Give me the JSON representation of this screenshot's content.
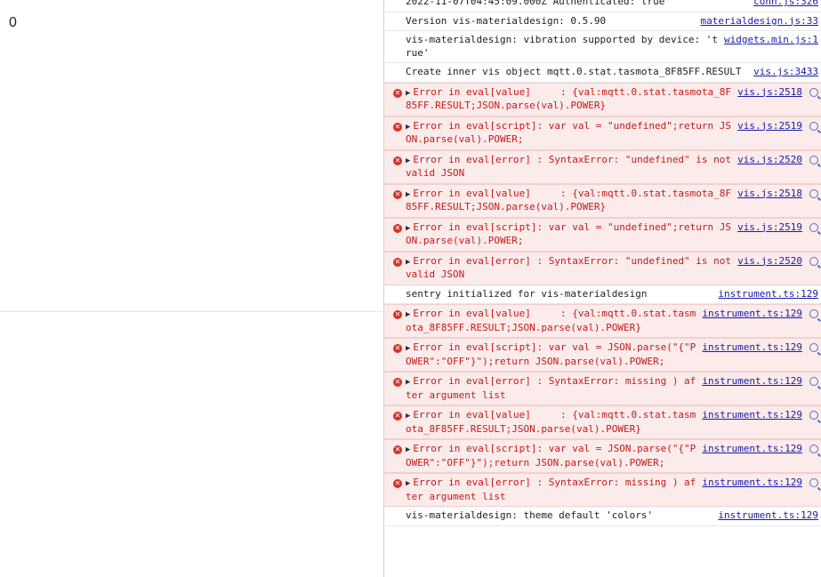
{
  "left_pane": {
    "value": "0"
  },
  "console": {
    "messages": [
      {
        "level": "info",
        "text": "2022-11-07T04:45:09.000Z Authenticated: true",
        "source": "conn.js:326"
      },
      {
        "level": "info",
        "text": "Version vis-materialdesign: 0.5.90",
        "source": "materialdesign.js:33"
      },
      {
        "level": "info",
        "text": "vis-materialdesign: vibration supported by device: 'true'",
        "source": "widgets.min.js:1"
      },
      {
        "level": "info",
        "text": "Create inner vis object mqtt.0.stat.tasmota_8F85FF.RESULT",
        "source": "vis.js:3433"
      },
      {
        "level": "error",
        "text": "Error in eval[value]     : {val:mqtt.0.stat.tasmota_8F85FF.RESULT;JSON.parse(val).POWER}",
        "source": "vis.js:2518"
      },
      {
        "level": "error",
        "text": "Error in eval[script]: var val = \"undefined\";return JSON.parse(val).POWER;",
        "source": "vis.js:2519"
      },
      {
        "level": "error",
        "text": "Error in eval[error] : SyntaxError: \"undefined\" is not valid JSON",
        "source": "vis.js:2520"
      },
      {
        "level": "error",
        "text": "Error in eval[value]     : {val:mqtt.0.stat.tasmota_8F85FF.RESULT;JSON.parse(val).POWER}",
        "source": "vis.js:2518"
      },
      {
        "level": "error",
        "text": "Error in eval[script]: var val = \"undefined\";return JSON.parse(val).POWER;",
        "source": "vis.js:2519"
      },
      {
        "level": "error",
        "text": "Error in eval[error] : SyntaxError: \"undefined\" is not valid JSON",
        "source": "vis.js:2520"
      },
      {
        "level": "info",
        "text": "sentry initialized for vis-materialdesign",
        "source": "instrument.ts:129"
      },
      {
        "level": "error",
        "text": "Error in eval[value]     : {val:mqtt.0.stat.tasmota_8F85FF.RESULT;JSON.parse(val).POWER}",
        "source": "instrument.ts:129"
      },
      {
        "level": "error",
        "text": "Error in eval[script]: var val = JSON.parse(\"{\"POWER\":\"OFF\"}\");return JSON.parse(val).POWER;",
        "source": "instrument.ts:129"
      },
      {
        "level": "error",
        "text": "Error in eval[error] : SyntaxError: missing ) after argument list",
        "source": "instrument.ts:129"
      },
      {
        "level": "error",
        "text": "Error in eval[value]     : {val:mqtt.0.stat.tasmota_8F85FF.RESULT;JSON.parse(val).POWER}",
        "source": "instrument.ts:129"
      },
      {
        "level": "error",
        "text": "Error in eval[script]: var val = JSON.parse(\"{\"POWER\":\"OFF\"}\");return JSON.parse(val).POWER;",
        "source": "instrument.ts:129"
      },
      {
        "level": "error",
        "text": "Error in eval[error] : SyntaxError: missing ) after argument list",
        "source": "instrument.ts:129"
      },
      {
        "level": "info",
        "text": "vis-materialdesign: theme default 'colors'",
        "source": "instrument.ts:129"
      }
    ]
  },
  "colors": {
    "error_bg": "#fcebeb",
    "error_text": "#c41a16",
    "link": "#1a1aa6",
    "error_icon": "#d93025"
  }
}
